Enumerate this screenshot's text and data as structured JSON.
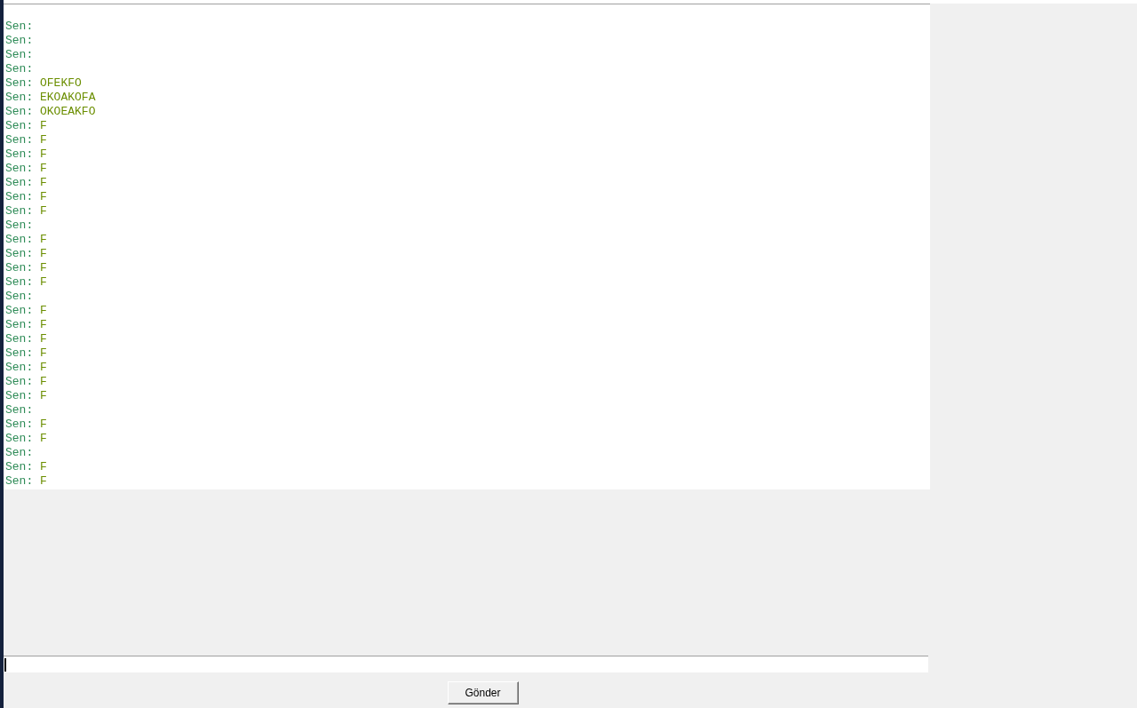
{
  "chat_log": [
    {
      "sender": "Sen:"
    },
    {
      "sender": "Sen:"
    },
    {
      "sender": "Sen:"
    },
    {
      "sender": "Sen:"
    },
    {
      "sender": "Sen:",
      "text": "OFEKFO"
    },
    {
      "sender": "Sen:",
      "text": "EKOAKOFA"
    },
    {
      "sender": "Sen:",
      "text": "OKOEAKFO"
    },
    {
      "sender": "Sen:",
      "text": "F"
    },
    {
      "sender": "Sen:",
      "text": "F"
    },
    {
      "sender": "Sen:",
      "text": "F"
    },
    {
      "sender": "Sen:",
      "text": "F"
    },
    {
      "sender": "Sen:",
      "text": "F"
    },
    {
      "sender": "Sen:",
      "text": "F"
    },
    {
      "sender": "Sen:",
      "text": "F"
    },
    {
      "sender": "Sen:"
    },
    {
      "sender": "Sen:",
      "text": "F"
    },
    {
      "sender": "Sen:",
      "text": "F"
    },
    {
      "sender": "Sen:",
      "text": "F"
    },
    {
      "sender": "Sen:",
      "text": "F"
    },
    {
      "sender": "Sen:"
    },
    {
      "sender": "Sen:",
      "text": "F"
    },
    {
      "sender": "Sen:",
      "text": "F"
    },
    {
      "sender": "Sen:",
      "text": "F"
    },
    {
      "sender": "Sen:",
      "text": "F"
    },
    {
      "sender": "Sen:",
      "text": "F"
    },
    {
      "sender": "Sen:",
      "text": "F"
    },
    {
      "sender": "Sen:",
      "text": "F"
    },
    {
      "sender": "Sen:"
    },
    {
      "sender": "Sen:",
      "text": "F"
    },
    {
      "sender": "Sen:",
      "text": "F"
    },
    {
      "sender": "Sen:"
    },
    {
      "sender": "Sen:",
      "text": "F"
    },
    {
      "sender": "Sen:",
      "text": "F"
    }
  ],
  "send_button": {
    "label": "Gönder"
  }
}
